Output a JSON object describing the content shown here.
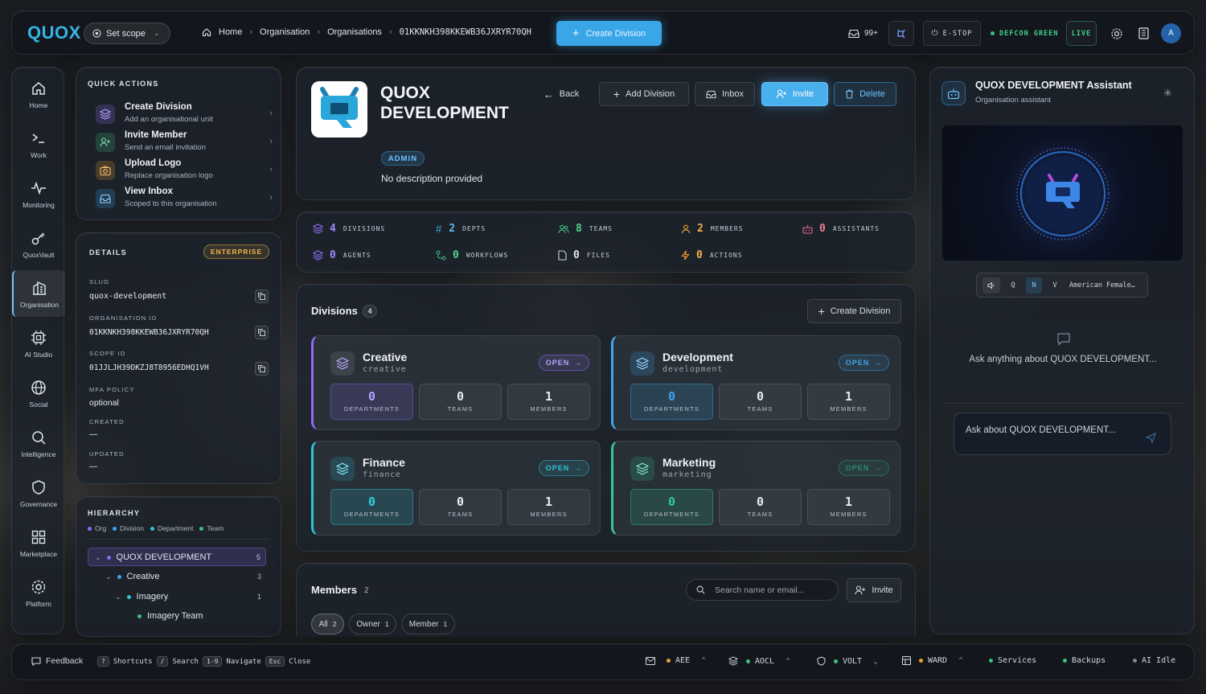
{
  "topbar": {
    "logo": "QUOX",
    "scope_label": "Set scope",
    "breadcrumbs": [
      "Home",
      "Organisation",
      "Organisations",
      "01KKNKH398KKEWB36JXRYR70QH"
    ],
    "create_division": "Create Division",
    "inbox_count": "99+",
    "estop": "E-STOP",
    "defcon": "DEFCON GREEN",
    "live": "LIVE",
    "avatar": "A"
  },
  "sidebar": [
    {
      "label": "Home",
      "icon": "home-icon"
    },
    {
      "label": "Work",
      "icon": "terminal-icon"
    },
    {
      "label": "Monitoring",
      "icon": "pulse-icon"
    },
    {
      "label": "QuoxVault",
      "icon": "key-icon"
    },
    {
      "label": "Organisation",
      "icon": "building-icon"
    },
    {
      "label": "AI Studio",
      "icon": "chip-icon"
    },
    {
      "label": "Social",
      "icon": "globe-icon"
    },
    {
      "label": "Intelligence",
      "icon": "search-icon"
    },
    {
      "label": "Governance",
      "icon": "shield-icon"
    },
    {
      "label": "Marketplace",
      "icon": "grid-icon"
    },
    {
      "label": "Platform",
      "icon": "gear-icon"
    }
  ],
  "quick_actions": {
    "title": "QUICK ACTIONS",
    "items": [
      {
        "title": "Create Division",
        "sub": "Add an organisational unit",
        "color": "#8b6cf2"
      },
      {
        "title": "Invite Member",
        "sub": "Send an email invitation",
        "color": "#3fbf7f"
      },
      {
        "title": "Upload Logo",
        "sub": "Replace organisation logo",
        "color": "#f0a030"
      },
      {
        "title": "View Inbox",
        "sub": "Scoped to this organisation",
        "color": "#3ea5e8"
      }
    ]
  },
  "details": {
    "title": "DETAILS",
    "tier": "ENTERPRISE",
    "slug_label": "SLUG",
    "slug": "quox-development",
    "org_id_label": "ORGANISATION ID",
    "org_id": "01KKNKH398KKEWB36JXRYR70QH",
    "scope_id_label": "SCOPE ID",
    "scope_id": "01JJLJH39DKZJ8T8956EDHQ1VH",
    "mfa_label": "MFA POLICY",
    "mfa": "optional",
    "created_label": "CREATED",
    "created": "—",
    "updated_label": "UPDATED",
    "updated": "—"
  },
  "hierarchy": {
    "title": "HIERARCHY",
    "legend": [
      "Org",
      "Division",
      "Department",
      "Team"
    ],
    "nodes": [
      {
        "label": "QUOX DEVELOPMENT",
        "count": "5"
      },
      {
        "label": "Creative",
        "count": "3"
      },
      {
        "label": "Imagery",
        "count": "1"
      },
      {
        "label": "Imagery Team",
        "count": ""
      }
    ]
  },
  "org": {
    "name_line1": "QUOX",
    "name_line2": "DEVELOPMENT",
    "role": "ADMIN",
    "description": "No description provided",
    "actions": {
      "back": "Back",
      "add_division": "Add Division",
      "inbox": "Inbox",
      "invite": "Invite",
      "delete": "Delete"
    }
  },
  "stats": [
    {
      "value": "4",
      "label": "DIVISIONS",
      "color": "#8b6cf2"
    },
    {
      "value": "2",
      "label": "DEPTS",
      "color": "#3ea5e8"
    },
    {
      "value": "8",
      "label": "TEAMS",
      "color": "#3fbf7f"
    },
    {
      "value": "2",
      "label": "MEMBERS",
      "color": "#f0a030"
    },
    {
      "value": "0",
      "label": "ASSISTANTS",
      "color": "#e86a8a"
    },
    {
      "value": "0",
      "label": "AGENTS",
      "color": "#8b6cf2"
    },
    {
      "value": "0",
      "label": "WORKFLOWS",
      "color": "#3fbf7f"
    },
    {
      "value": "0",
      "label": "FILES",
      "color": "#c9d1dc"
    },
    {
      "value": "0",
      "label": "ACTIONS",
      "color": "#f0a030"
    }
  ],
  "divisions": {
    "title": "Divisions",
    "count": "4",
    "create": "Create Division",
    "open_label": "OPEN",
    "labels": {
      "departments": "DEPARTMENTS",
      "teams": "TEAMS",
      "members": "MEMBERS"
    },
    "items": [
      {
        "name": "Creative",
        "slug": "creative",
        "departments": "0",
        "teams": "0",
        "members": "1",
        "color": "#8b6cf2"
      },
      {
        "name": "Development",
        "slug": "development",
        "departments": "0",
        "teams": "0",
        "members": "1",
        "color": "#3ea5e8"
      },
      {
        "name": "Finance",
        "slug": "finance",
        "departments": "0",
        "teams": "0",
        "members": "1",
        "color": "#2fc4d6"
      },
      {
        "name": "Marketing",
        "slug": "marketing",
        "departments": "0",
        "teams": "0",
        "members": "1",
        "color": "#34c79a"
      }
    ]
  },
  "members": {
    "title": "Members",
    "count": "2",
    "search_placeholder": "Search name or email...",
    "invite": "Invite",
    "filters": [
      {
        "label": "All",
        "count": "2"
      },
      {
        "label": "Owner",
        "count": "1"
      },
      {
        "label": "Member",
        "count": "1"
      }
    ]
  },
  "assistant": {
    "title": "QUOX DEVELOPMENT Assistant",
    "subtitle": "Organisation assistant",
    "voice_keys": [
      "Q",
      "N",
      "V"
    ],
    "voice": "American Female…",
    "prompt": "Ask anything about QUOX DEVELOPMENT...",
    "input_placeholder": "Ask about QUOX DEVELOPMENT..."
  },
  "bottombar": {
    "feedback": "Feedback",
    "shortcuts": [
      {
        "key": "?",
        "label": "Shortcuts"
      },
      {
        "key": "/",
        "label": "Search"
      },
      {
        "key": "1-9",
        "label": "Navigate"
      },
      {
        "key": "Esc",
        "label": "Close"
      }
    ],
    "status": [
      {
        "label": "AEE",
        "color": "#f0a030"
      },
      {
        "label": "AOCL",
        "color": "#3fbf7f"
      },
      {
        "label": "VOLT",
        "color": "#3fbf7f"
      },
      {
        "label": "WARD",
        "color": "#f0a030"
      },
      {
        "label": "Services",
        "color": "#3fbf7f"
      },
      {
        "label": "Backups",
        "color": "#3fbf7f"
      },
      {
        "label": "AI Idle",
        "color": "#7c8592"
      }
    ]
  }
}
